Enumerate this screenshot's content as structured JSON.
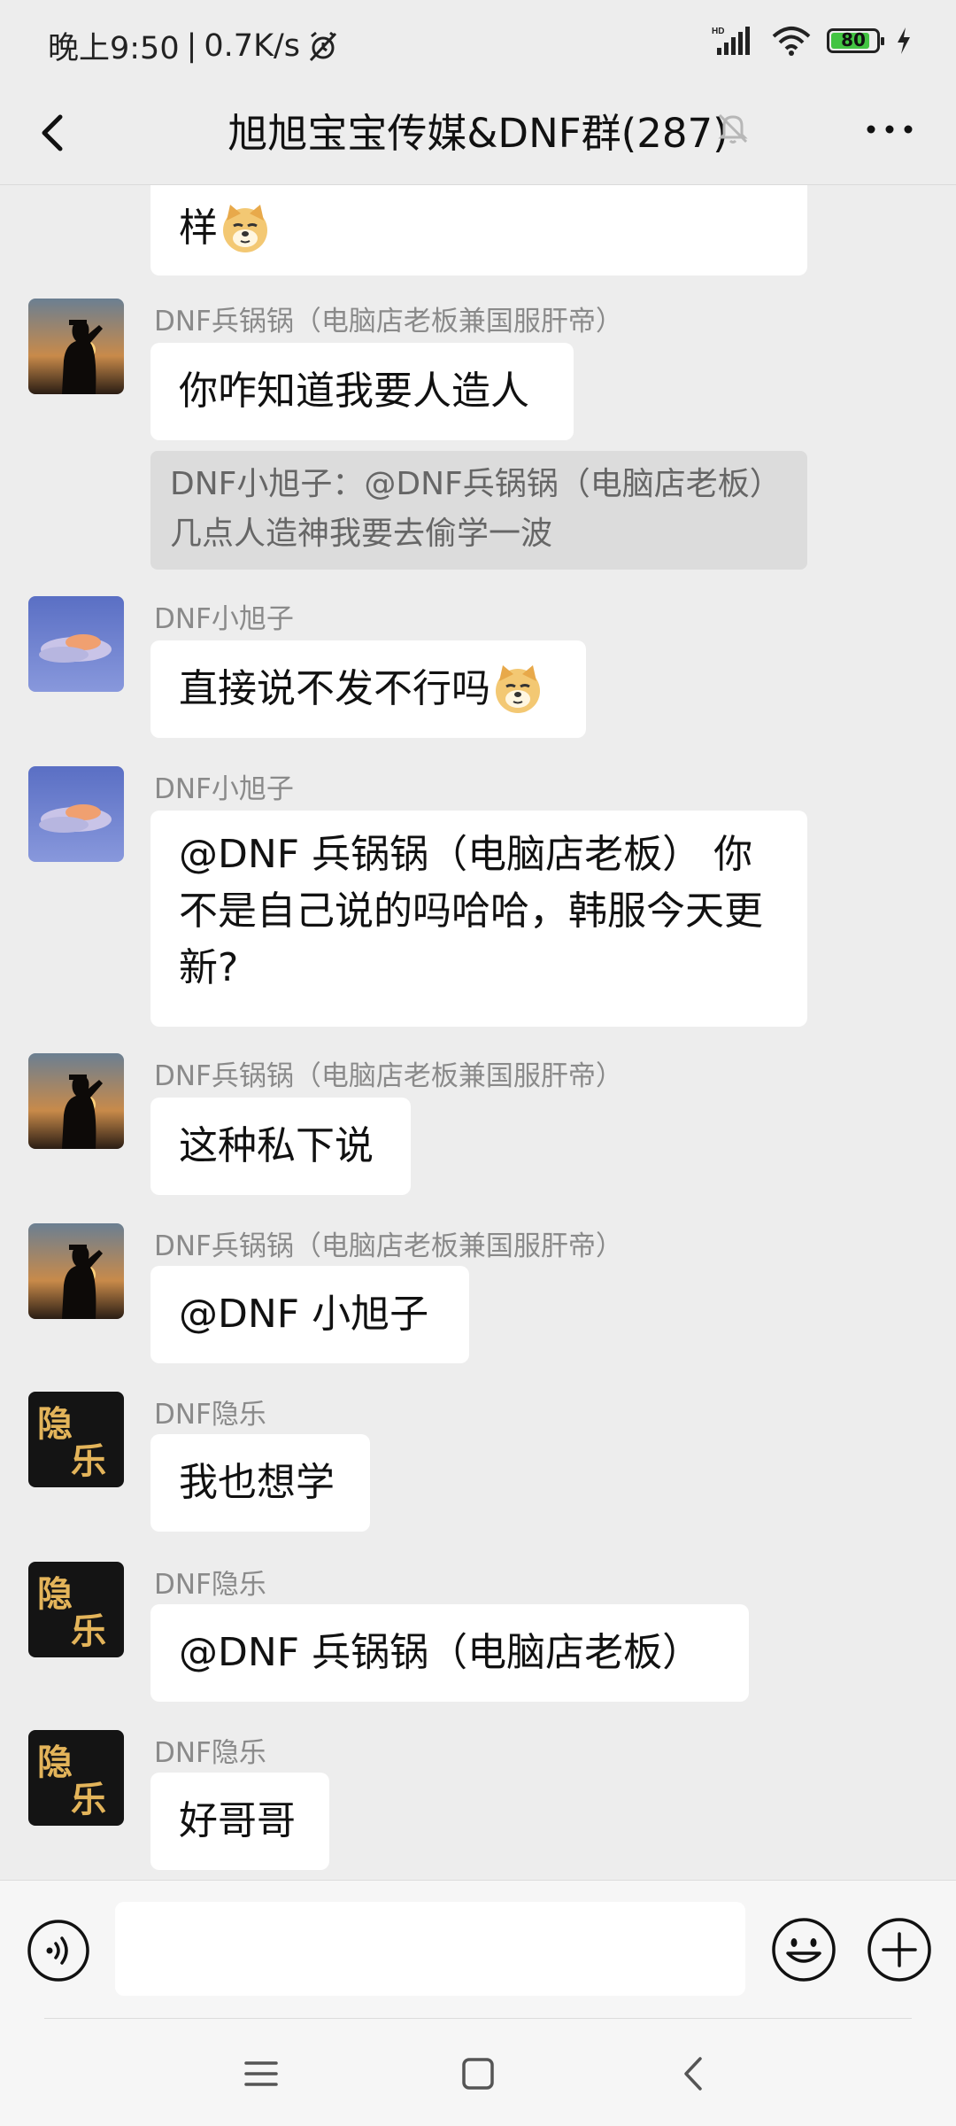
{
  "status_bar": {
    "time": "晚上9:50",
    "network_speed": "0.7K/s",
    "battery": "80"
  },
  "nav": {
    "title": "旭旭宝宝传媒&DNF群(287)"
  },
  "messages": [
    {
      "sender": "",
      "text": "样",
      "emoji": "doge-emoji"
    },
    {
      "sender": "DNF兵锅锅（电脑店老板兼国服肝帝）",
      "text": "你咋知道我要人造人",
      "avatar": "soldier-salute-avatar",
      "quote": "DNF小旭子：@DNF兵锅锅（电脑店老板） 几点人造神我要去偷学一波"
    },
    {
      "sender": "DNF小旭子",
      "text": "直接说不发不行吗",
      "emoji": "doge-emoji",
      "avatar": "sunset-cloud-avatar"
    },
    {
      "sender": "DNF小旭子",
      "text_lines": [
        "@DNF 兵锅锅（电脑店老板） 你",
        "不是自己说的吗哈哈，韩服今天更",
        "新?"
      ],
      "avatar": "sunset-cloud-avatar"
    },
    {
      "sender": "DNF兵锅锅（电脑店老板兼国服肝帝）",
      "text": "这种私下说",
      "avatar": "soldier-salute-avatar"
    },
    {
      "sender": "DNF兵锅锅（电脑店老板兼国服肝帝）",
      "text": "@DNF 小旭子",
      "avatar": "soldier-salute-avatar"
    },
    {
      "sender": "DNF隐乐",
      "text": "我也想学",
      "avatar": "yinle-calligraphy-avatar"
    },
    {
      "sender": "DNF隐乐",
      "text": "@DNF 兵锅锅（电脑店老板）",
      "avatar": "yinle-calligraphy-avatar"
    },
    {
      "sender": "DNF隐乐",
      "text": "好哥哥",
      "avatar": "yinle-calligraphy-avatar"
    }
  ],
  "input": {
    "value": ""
  },
  "colors": {
    "chat_background": "#ededed",
    "bubble": "#ffffff",
    "quote_background": "#dcdcdc",
    "sender_text": "#8a8a8a",
    "battery_fill": "#43c443"
  }
}
